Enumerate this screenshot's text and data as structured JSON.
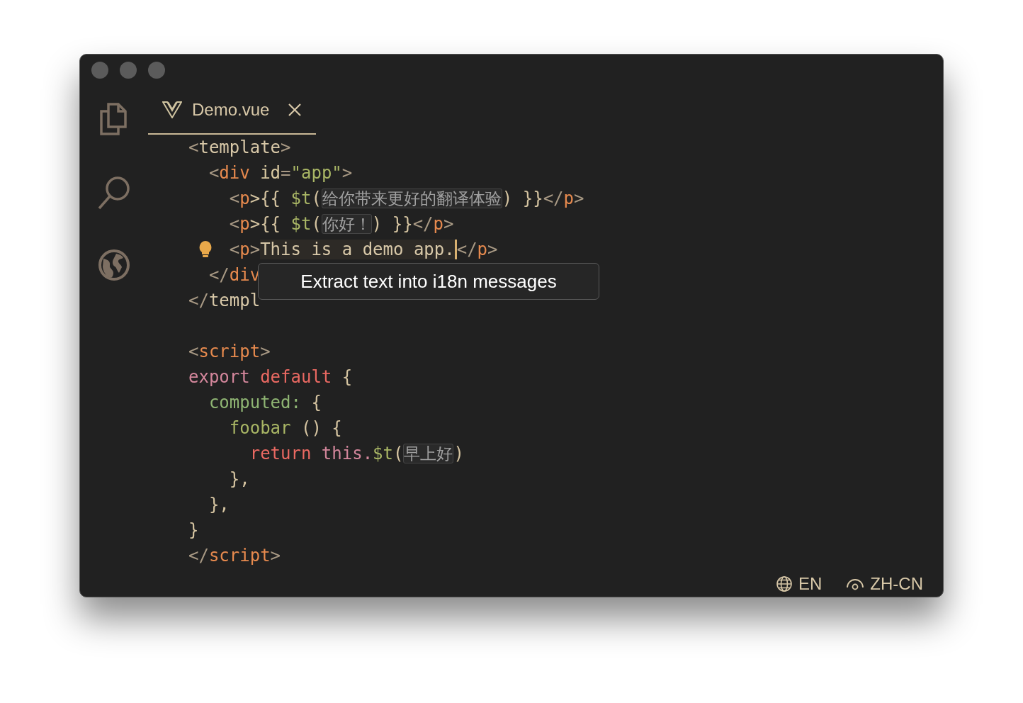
{
  "tabs": [
    {
      "title": "Demo.vue",
      "selected": true
    }
  ],
  "code": [
    {
      "kind": "code",
      "tokens": [
        {
          "text": "<",
          "kind": "punct"
        },
        {
          "text": "template",
          "kind": "tag2"
        },
        {
          "text": ">",
          "kind": "punct"
        }
      ]
    },
    {
      "kind": "code",
      "tokens": [
        {
          "text": "  <",
          "kind": "punct"
        },
        {
          "text": "div",
          "kind": "tag"
        },
        {
          "text": " id",
          "kind": "attr"
        },
        {
          "text": "=",
          "kind": "punct"
        },
        {
          "text": "\"app\"",
          "kind": "string"
        },
        {
          "text": ">",
          "kind": "punct"
        }
      ]
    },
    {
      "kind": "code",
      "tokens": [
        {
          "text": "    <",
          "kind": "punct"
        },
        {
          "text": "p",
          "kind": "tag"
        },
        {
          "text": ">{{ ",
          "kind": "plain"
        },
        {
          "text": "$t",
          "kind": "fn"
        },
        {
          "text": "(",
          "kind": "plain"
        },
        {
          "text": "给你带来更好的翻译体验",
          "kind": "i18n"
        },
        {
          "text": ") }}",
          "kind": "plain"
        },
        {
          "text": "</",
          "kind": "punct"
        },
        {
          "text": "p",
          "kind": "tag"
        },
        {
          "text": ">",
          "kind": "punct"
        }
      ]
    },
    {
      "kind": "code",
      "tokens": [
        {
          "text": "    <",
          "kind": "punct"
        },
        {
          "text": "p",
          "kind": "tag"
        },
        {
          "text": ">{{ ",
          "kind": "plain"
        },
        {
          "text": "$t",
          "kind": "fn"
        },
        {
          "text": "(",
          "kind": "plain"
        },
        {
          "text": "你好！",
          "kind": "i18n"
        },
        {
          "text": ") }}",
          "kind": "plain"
        },
        {
          "text": "</",
          "kind": "punct"
        },
        {
          "text": "p",
          "kind": "tag"
        },
        {
          "text": ">",
          "kind": "punct"
        }
      ]
    },
    {
      "kind": "code",
      "lightbulb": true,
      "tokens": [
        {
          "text": "    <",
          "kind": "punct"
        },
        {
          "text": "p",
          "kind": "tag"
        },
        {
          "text": ">",
          "kind": "punct"
        },
        {
          "text": "This is a demo app.",
          "kind": "selection"
        },
        {
          "text": "</",
          "kind": "punct"
        },
        {
          "text": "p",
          "kind": "tag"
        },
        {
          "text": ">",
          "kind": "punct"
        }
      ]
    },
    {
      "kind": "code",
      "tokens": [
        {
          "text": "  </",
          "kind": "punct"
        },
        {
          "text": "div",
          "kind": "tag"
        }
      ]
    },
    {
      "kind": "code",
      "tokens": [
        {
          "text": "</",
          "kind": "punct"
        },
        {
          "text": "templ",
          "kind": "tag2"
        }
      ]
    },
    {
      "kind": "blank"
    },
    {
      "kind": "code",
      "tokens": [
        {
          "text": "<",
          "kind": "punct"
        },
        {
          "text": "script",
          "kind": "tag"
        },
        {
          "text": ">",
          "kind": "punct"
        }
      ]
    },
    {
      "kind": "code",
      "tokens": [
        {
          "text": "export ",
          "kind": "keyword"
        },
        {
          "text": "default",
          "kind": "keyword2"
        },
        {
          "text": " {",
          "kind": "plain"
        }
      ]
    },
    {
      "kind": "code",
      "tokens": [
        {
          "text": "  computed:",
          "kind": "prop"
        },
        {
          "text": " {",
          "kind": "plain"
        }
      ]
    },
    {
      "kind": "code",
      "tokens": [
        {
          "text": "    foobar",
          "kind": "fn"
        },
        {
          "text": " () {",
          "kind": "plain"
        }
      ]
    },
    {
      "kind": "code",
      "tokens": [
        {
          "text": "      return ",
          "kind": "keyword2"
        },
        {
          "text": "this.",
          "kind": "keyword"
        },
        {
          "text": "$t",
          "kind": "fn"
        },
        {
          "text": "(",
          "kind": "plain"
        },
        {
          "text": "早上好",
          "kind": "i18n"
        },
        {
          "text": ")",
          "kind": "plain"
        }
      ]
    },
    {
      "kind": "code",
      "tokens": [
        {
          "text": "    },",
          "kind": "plain"
        }
      ]
    },
    {
      "kind": "code",
      "tokens": [
        {
          "text": "  },",
          "kind": "plain"
        }
      ]
    },
    {
      "kind": "code",
      "tokens": [
        {
          "text": "}",
          "kind": "plain"
        }
      ]
    },
    {
      "kind": "code",
      "tokens": [
        {
          "text": "</",
          "kind": "punct"
        },
        {
          "text": "script",
          "kind": "tag"
        },
        {
          "text": ">",
          "kind": "punct"
        }
      ]
    }
  ],
  "tooltip": {
    "text": "Extract text into i18n messages"
  },
  "status_bar": [
    {
      "label": "EN",
      "kind": "locale"
    },
    {
      "label": "ZH-CN",
      "kind": "display"
    }
  ]
}
